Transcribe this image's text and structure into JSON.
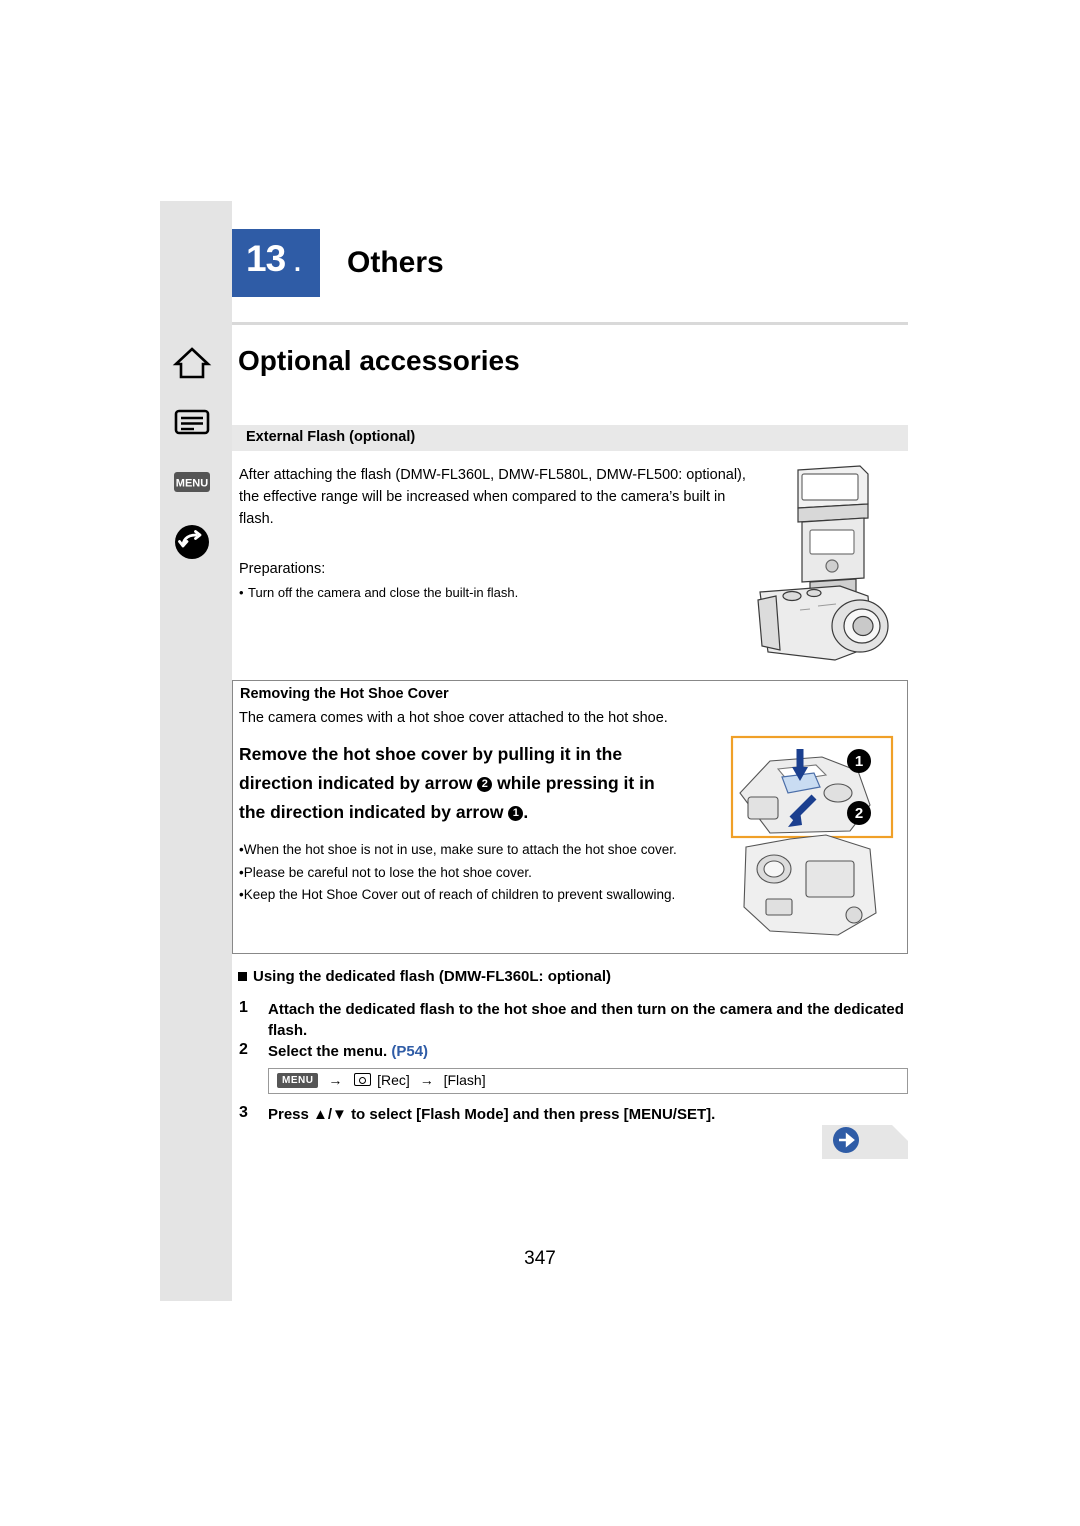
{
  "chapter": {
    "number": "13",
    "dot": ".",
    "title": "Others"
  },
  "page_title": "Optional accessories",
  "nav_icons": [
    {
      "name": "home-icon",
      "label": "Home"
    },
    {
      "name": "contents-icon",
      "label": "Contents"
    },
    {
      "name": "menu-icon",
      "label": "MENU"
    },
    {
      "name": "back-icon",
      "label": "Back"
    }
  ],
  "section": {
    "bar_label": "External Flash (optional)",
    "intro": "After attaching the flash (DMW-FL360L, DMW-FL580L, DMW-FL500: optional), the effective range will be increased when compared to the camera’s built in flash.",
    "preparations_label": "Preparations:",
    "preparations_bullet": "Turn off the camera and close the built-in flash."
  },
  "hot_shoe": {
    "heading": "Removing the Hot Shoe Cover",
    "subtext": "The camera comes with a hot shoe cover attached to the hot shoe.",
    "instruction_line1": "Remove the hot shoe cover by pulling it in the",
    "instruction_line2_a": "direction indicated by arrow ",
    "instruction_line2_num": "2",
    "instruction_line2_b": " while pressing it in",
    "instruction_line3_a": "the direction indicated by arrow ",
    "instruction_line3_num": "1",
    "instruction_line3_b": ".",
    "bullets": [
      "When the hot shoe is not in use, make sure to attach the hot shoe cover.",
      "Please be careful not to lose the hot shoe cover.",
      "Keep the Hot Shoe Cover out of reach of children to prevent swallowing."
    ],
    "callout_1": "1",
    "callout_2": "2"
  },
  "steps": {
    "heading": "Using the dedicated flash (DMW-FL360L: optional)",
    "items": [
      {
        "num": "1",
        "text": "Attach the dedicated flash to the hot shoe and then turn on the camera and the dedicated flash."
      },
      {
        "num": "2",
        "text": "Select the menu. ",
        "ref": "(P54)"
      },
      {
        "num": "3",
        "text": "Press ▲/▼ to select [Flash Mode] and then press [MENU/SET]."
      }
    ],
    "menu_path": {
      "chip": "MENU",
      "arrow1": "→",
      "rec": "[Rec]",
      "arrow2": "→",
      "flash": "[Flash]"
    }
  },
  "page_number": "347",
  "colors": {
    "accent_blue": "#2f5ca6",
    "rail_gray": "#e4e4e4",
    "bar_gray": "#e8e8e8"
  }
}
